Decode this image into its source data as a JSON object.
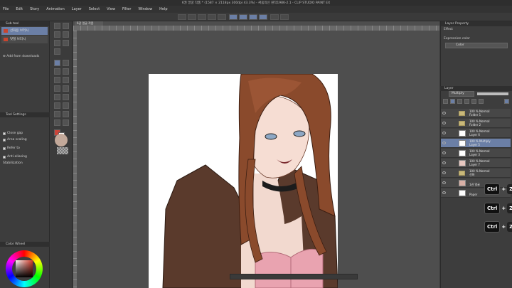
{
  "window": {
    "title": "6권 얼굴 작품 * (1587 × 2118px 300dpi 43.3%) - 싸움의신 원작1986-2.1 - CLIP STUDIO PAINT EX"
  },
  "menu": [
    "File",
    "Edit",
    "Story",
    "Animation",
    "Layer",
    "Select",
    "View",
    "Filter",
    "Window",
    "Help"
  ],
  "subtool_panel": {
    "title": "Sub tool",
    "items": [
      {
        "label": "선화용 브러시"
      },
      {
        "label": "덧칠 브러시"
      }
    ],
    "add_from_downloads": "Add from downloads"
  },
  "tool_property": {
    "title": "Tool Settings",
    "options": [
      {
        "label": "Close gap"
      },
      {
        "label": "Area scaling"
      },
      {
        "label": "Refer to"
      },
      {
        "label": "Anti-aliasing"
      },
      {
        "label": "Stabilization"
      }
    ]
  },
  "canvas": {
    "tab_label": "6권 얼굴 작품"
  },
  "color_wheel": {
    "title": "Color Wheel"
  },
  "layer_property": {
    "title": "Layer Property",
    "effect_label": "Effect",
    "expression_color_label": "Expression color",
    "expression_color_value": "Color"
  },
  "layer_panel": {
    "title": "Layer",
    "blend_mode": "Multiply",
    "layers": [
      {
        "line1": "100 % Normal",
        "line2": "Folder 1",
        "type": "folder"
      },
      {
        "line1": "100 % Normal",
        "line2": "Folder 2",
        "type": "folder"
      },
      {
        "line1": "100 % Normal",
        "line2": "Layer 6",
        "type": "layer"
      },
      {
        "line1": "100 % Multiply",
        "line2": "Layer 5",
        "type": "layer",
        "selected": true
      },
      {
        "line1": "100 % Normal",
        "line2": "Layer 3",
        "type": "layer"
      },
      {
        "line1": "100 % Normal",
        "line2": "Layer 7",
        "type": "layer"
      },
      {
        "line1": "100 % Normal",
        "line2": "선화",
        "type": "folder"
      },
      {
        "line1": "",
        "line2": "1권 얼굴",
        "type": "layer"
      },
      {
        "line1": "",
        "line2": "Paper",
        "type": "paper"
      }
    ]
  },
  "shortcut_overlay": [
    {
      "key1": "Ctrl",
      "plus": "+",
      "key2": "Z"
    },
    {
      "key1": "Ctrl",
      "plus": "+",
      "key2": "Z"
    },
    {
      "key1": "Ctrl",
      "plus": "+",
      "key2": "Z"
    }
  ]
}
